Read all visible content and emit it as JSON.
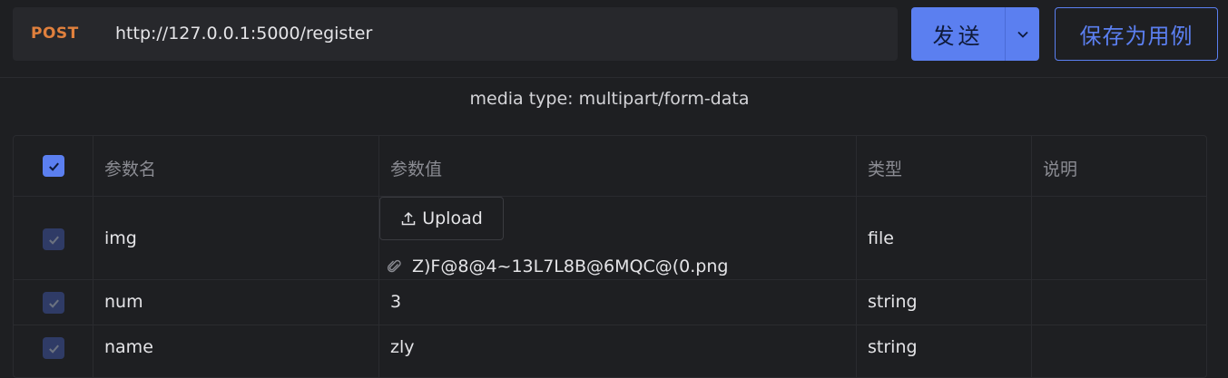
{
  "request": {
    "method": "POST",
    "url": "http://127.0.0.1:5000/register"
  },
  "toolbar": {
    "send_label": "发送",
    "save_label": "保存为用例"
  },
  "body": {
    "media_type": "media type: multipart/form-data"
  },
  "table": {
    "headers": [
      "参数名",
      "参数值",
      "类型",
      "说明"
    ],
    "select_all_checked": true,
    "rows": [
      {
        "name": "img",
        "upload_label": "Upload",
        "file_name": "Z)F@8@4~13L7L8B@6MQC@(0.png",
        "type": "file",
        "desc": "",
        "checked": true
      },
      {
        "name": "num",
        "value": "3",
        "type": "string",
        "desc": "",
        "checked": true
      },
      {
        "name": "name",
        "value": "zly",
        "type": "string",
        "desc": "",
        "checked": true
      }
    ]
  },
  "colors": {
    "accent": "#5b7ff0",
    "method": "#e0803d",
    "background": "#1e1f22"
  },
  "icons": [
    "chevron-down-icon",
    "upload-icon",
    "paperclip-icon",
    "check-icon"
  ]
}
